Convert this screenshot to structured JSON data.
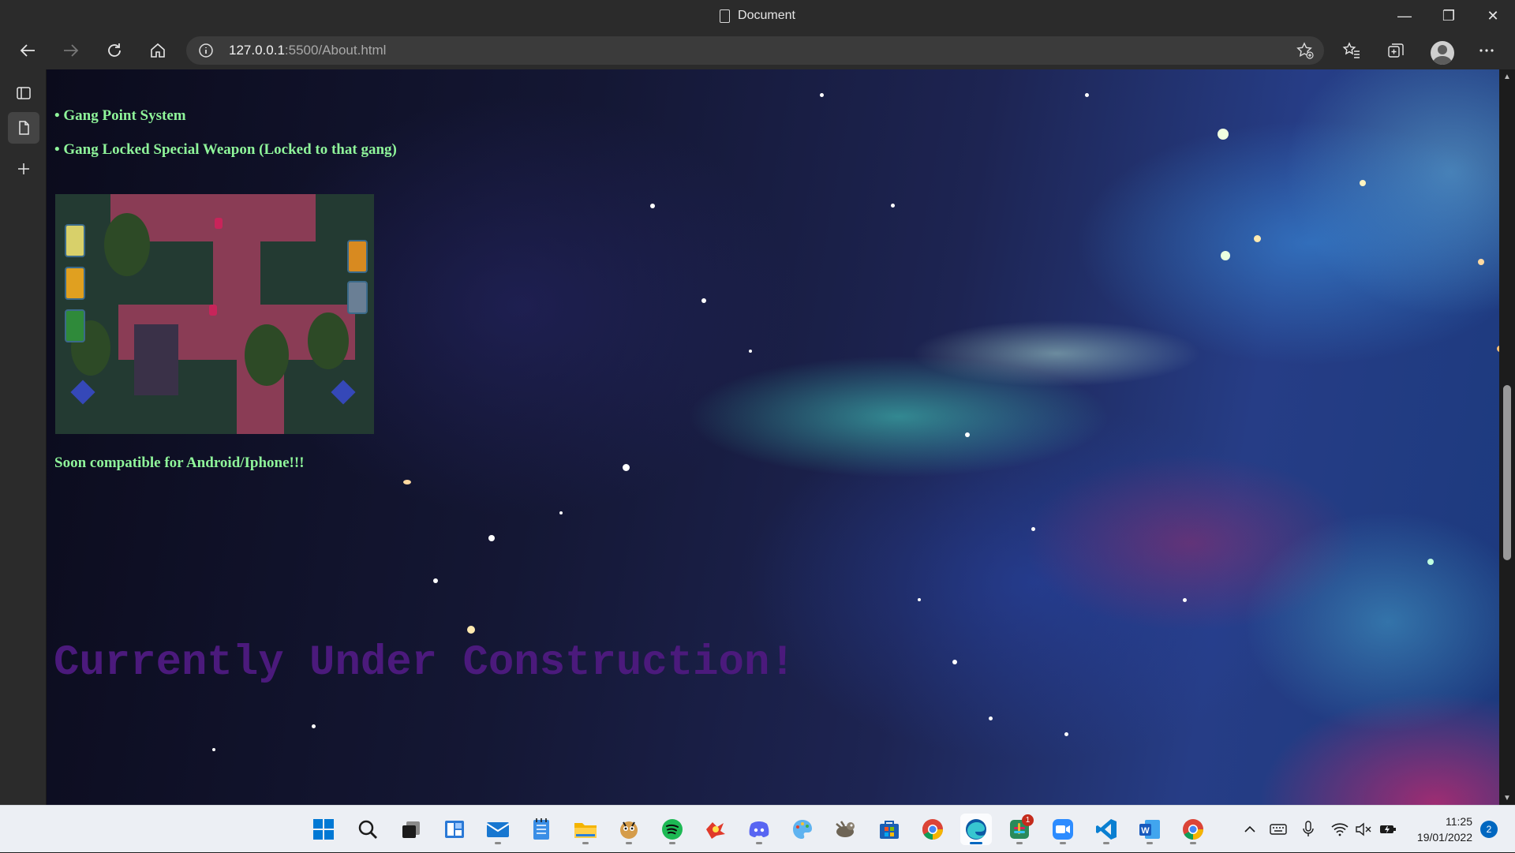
{
  "window": {
    "title": "Document"
  },
  "nav": {
    "url_host": "127.0.0.1",
    "url_rest": ":5500/About.html"
  },
  "page": {
    "bullets": [
      "• Gang Point System",
      "• Gang Locked Special Weapon (Locked to that gang)"
    ],
    "soon": "Soon compatible for Android/Iphone!!!",
    "construction": "Currently Under Construction!"
  },
  "taskbar": {
    "apps": [
      "start-icon",
      "search-icon",
      "task-view-icon",
      "widgets-icon",
      "mail-icon",
      "notepad-icon",
      "file-explorer-icon",
      "game-app-icon",
      "spotify-icon",
      "game-launcher-icon",
      "discord-icon",
      "paint-icon",
      "gimp-icon",
      "store-icon",
      "chrome-icon",
      "edge-icon",
      "slack-icon",
      "zoom-icon",
      "vscode-icon",
      "word-icon",
      "chrome-icon"
    ],
    "slack_badge": "1",
    "time": "11:25",
    "date": "19/01/2022",
    "notifications": "2"
  },
  "colors": {
    "bullet_text": "#8ff59a",
    "construction_text": "#4b1a7c",
    "accent": "#0067c0"
  }
}
